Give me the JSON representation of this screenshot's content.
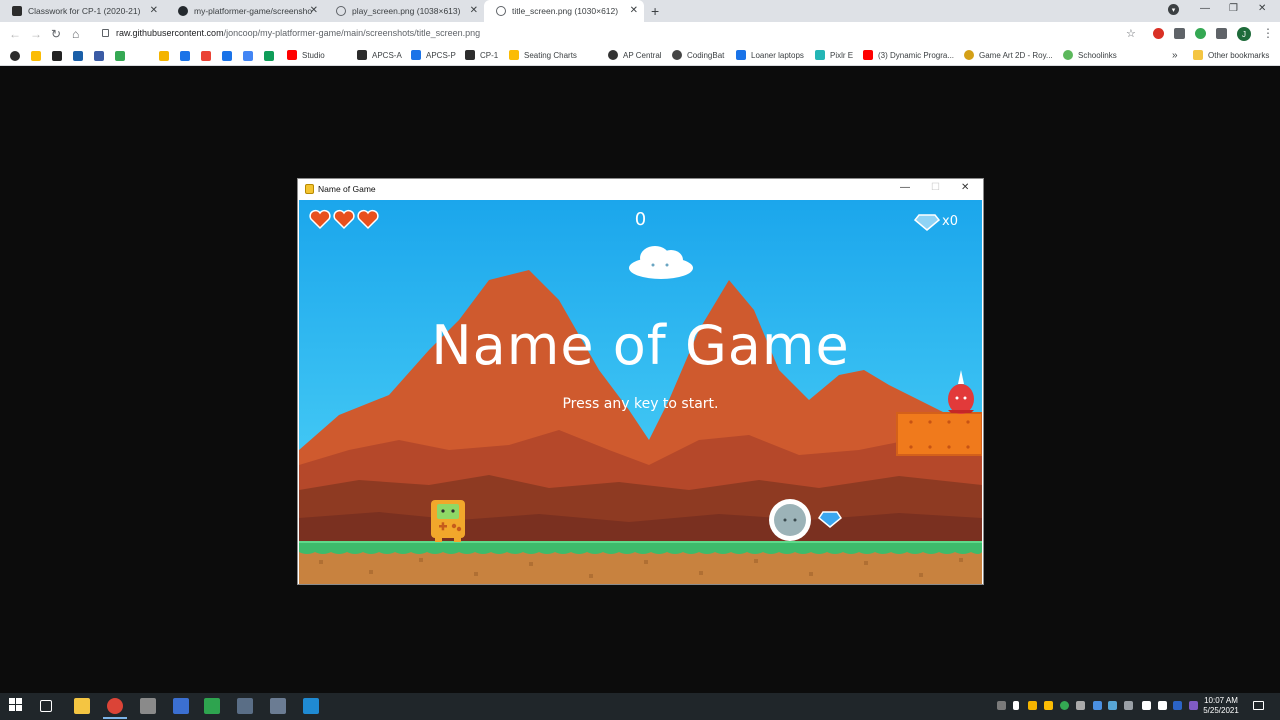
{
  "browser": {
    "tabs": [
      {
        "title": "Classwork for CP-1 (2020-21)",
        "icon": "classroom-icon",
        "color": "#2c2c2c"
      },
      {
        "title": "my-platformer-game/screenshot",
        "icon": "github-icon",
        "color": "#24292e"
      },
      {
        "title": "play_screen.png (1038×613)",
        "icon": "globe-icon",
        "color": "#5f6368"
      },
      {
        "title": "title_screen.png (1030×612)",
        "icon": "globe-icon",
        "color": "#5f6368"
      }
    ],
    "active_tab": 3,
    "url_host": "raw.githubusercontent.com",
    "url_path": "/joncoop/my-platformer-game/main/screenshots/title_screen.png",
    "profile_initial": "J",
    "bookmarks": [
      {
        "label": "Studio",
        "color": "#ff0000"
      },
      {
        "label": "APCS-A",
        "color": "#2c2c2c"
      },
      {
        "label": "APCS-P",
        "color": "#1a73e8"
      },
      {
        "label": "CP-1",
        "color": "#2c2c2c"
      },
      {
        "label": "Seating Charts",
        "color": "#fbbc04"
      },
      {
        "label": "AP Central",
        "color": "#333333"
      },
      {
        "label": "CodingBat",
        "color": "#444444"
      },
      {
        "label": "Loaner laptops",
        "color": "#1a73e8"
      },
      {
        "label": "Pixlr E",
        "color": "#23b5b5"
      },
      {
        "label": "(3) Dynamic Progra...",
        "color": "#ff0000"
      },
      {
        "label": "Game Art 2D - Roy...",
        "color": "#d4a017"
      },
      {
        "label": "Schoolinks",
        "color": "#5cb85c"
      }
    ],
    "other_bookmarks": "Other bookmarks"
  },
  "game_window": {
    "title": "Name of Game",
    "hud": {
      "hearts": 3,
      "score": "0",
      "gem_count": "x0"
    },
    "title_text": "Name of Game",
    "subtitle_text": "Press any key to start.",
    "colors": {
      "sky_top": "#1aa7ec",
      "sky_bottom": "#4fd4f7",
      "mountain": "#c0502a",
      "grass": "#3dbb6b",
      "dirt": "#c8823f",
      "heart": "#e8501d",
      "platform": "#f07a1c"
    }
  },
  "taskbar": {
    "time": "10:07 AM",
    "date": "5/25/2021"
  }
}
